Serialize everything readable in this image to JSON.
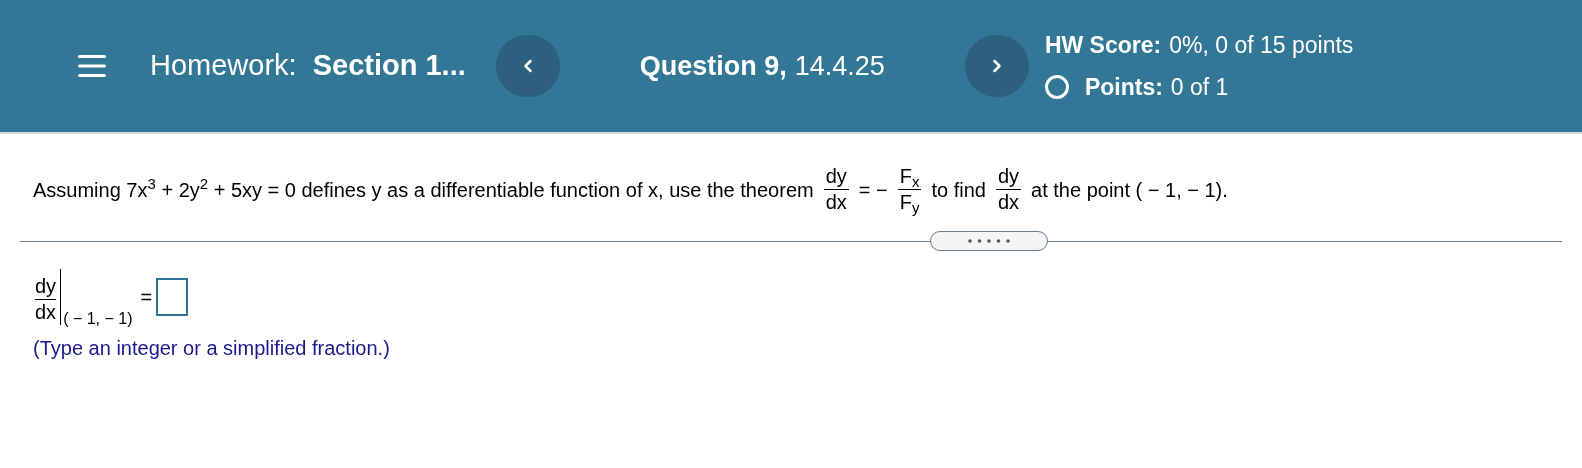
{
  "header": {
    "homework_label": "Homework:",
    "homework_title": "Section 1...",
    "question_label": "Question 9,",
    "question_number": "14.4.25",
    "hw_score_label": "HW Score:",
    "hw_score": "0%, 0 of 15 points",
    "points_label": "Points:",
    "points": "0 of 1"
  },
  "question": [
    {
      "kind": "text",
      "text": "Assuming 7x$^{3}$ + 2y$^{2}$ + 5xy = 0 defines y as a differentiable function of x, use the theorem"
    },
    {
      "kind": "fraction",
      "numerator": "dy",
      "denominator": "dx"
    },
    {
      "kind": "text",
      "text": "= −"
    },
    {
      "kind": "fraction",
      "numerator": "F$_{x}$",
      "denominator": "F$_{y}$"
    },
    {
      "kind": "text",
      "text": "to find"
    },
    {
      "kind": "fraction",
      "numerator": "dy",
      "denominator": "dx"
    },
    {
      "kind": "text",
      "text": "at the point ( − 1, − 1)."
    }
  ],
  "answer": {
    "numerator": "dy",
    "denominator": "dx",
    "point": "( − 1, − 1)",
    "equals": "=",
    "hint": "(Type an integer or a simplified fraction.)"
  }
}
